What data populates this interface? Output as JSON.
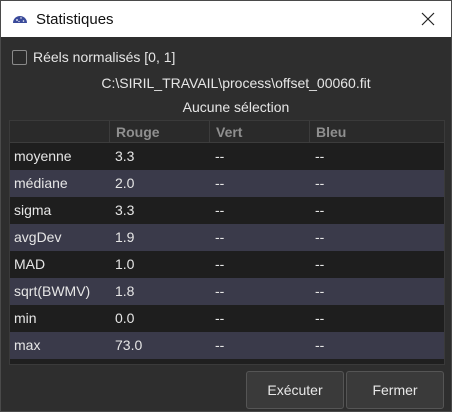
{
  "window": {
    "title": "Statistiques",
    "app_icon": "siril-app-icon",
    "close_icon": "close-icon"
  },
  "options": {
    "normalized_label": "Réels normalisés [0, 1]",
    "normalized_checked": false
  },
  "file_path": "C:\\SIRIL_TRAVAIL\\process\\offset_00060.fit",
  "selection_status": "Aucune sélection",
  "table": {
    "columns": [
      "",
      "Rouge",
      "Vert",
      "Bleu"
    ],
    "rows": [
      {
        "label": "moyenne",
        "r": "3.3",
        "g": "--",
        "b": "--"
      },
      {
        "label": "médiane",
        "r": "2.0",
        "g": "--",
        "b": "--"
      },
      {
        "label": "sigma",
        "r": "3.3",
        "g": "--",
        "b": "--"
      },
      {
        "label": "avgDev",
        "r": "1.9",
        "g": "--",
        "b": "--"
      },
      {
        "label": "MAD",
        "r": "1.0",
        "g": "--",
        "b": "--"
      },
      {
        "label": "sqrt(BWMV)",
        "r": "1.8",
        "g": "--",
        "b": "--"
      },
      {
        "label": "min",
        "r": "0.0",
        "g": "--",
        "b": "--"
      },
      {
        "label": "max",
        "r": "73.0",
        "g": "--",
        "b": "--"
      }
    ]
  },
  "buttons": {
    "run_label": "Exécuter",
    "close_label": "Fermer"
  }
}
